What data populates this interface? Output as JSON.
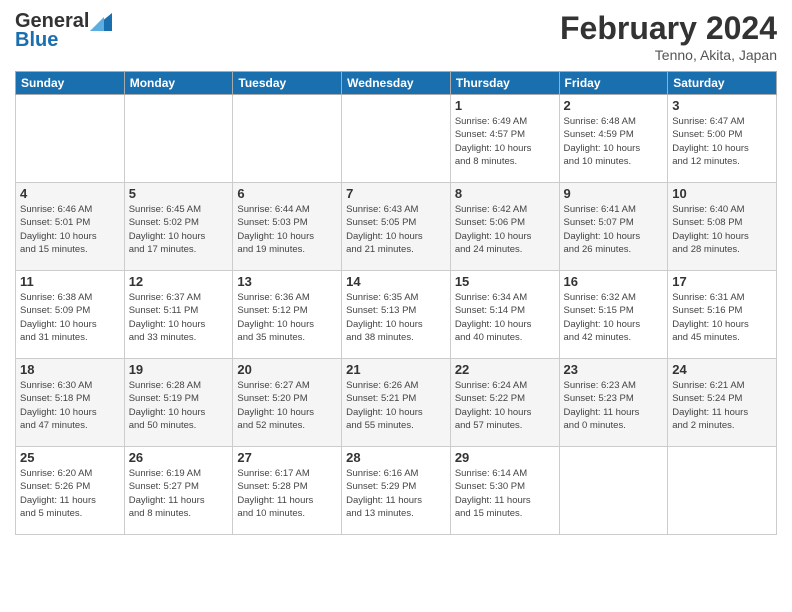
{
  "header": {
    "logo_line1": "General",
    "logo_line2": "Blue",
    "month_title": "February 2024",
    "subtitle": "Tenno, Akita, Japan"
  },
  "weekdays": [
    "Sunday",
    "Monday",
    "Tuesday",
    "Wednesday",
    "Thursday",
    "Friday",
    "Saturday"
  ],
  "weeks": [
    [
      {
        "day": "",
        "info": ""
      },
      {
        "day": "",
        "info": ""
      },
      {
        "day": "",
        "info": ""
      },
      {
        "day": "",
        "info": ""
      },
      {
        "day": "1",
        "info": "Sunrise: 6:49 AM\nSunset: 4:57 PM\nDaylight: 10 hours\nand 8 minutes."
      },
      {
        "day": "2",
        "info": "Sunrise: 6:48 AM\nSunset: 4:59 PM\nDaylight: 10 hours\nand 10 minutes."
      },
      {
        "day": "3",
        "info": "Sunrise: 6:47 AM\nSunset: 5:00 PM\nDaylight: 10 hours\nand 12 minutes."
      }
    ],
    [
      {
        "day": "4",
        "info": "Sunrise: 6:46 AM\nSunset: 5:01 PM\nDaylight: 10 hours\nand 15 minutes."
      },
      {
        "day": "5",
        "info": "Sunrise: 6:45 AM\nSunset: 5:02 PM\nDaylight: 10 hours\nand 17 minutes."
      },
      {
        "day": "6",
        "info": "Sunrise: 6:44 AM\nSunset: 5:03 PM\nDaylight: 10 hours\nand 19 minutes."
      },
      {
        "day": "7",
        "info": "Sunrise: 6:43 AM\nSunset: 5:05 PM\nDaylight: 10 hours\nand 21 minutes."
      },
      {
        "day": "8",
        "info": "Sunrise: 6:42 AM\nSunset: 5:06 PM\nDaylight: 10 hours\nand 24 minutes."
      },
      {
        "day": "9",
        "info": "Sunrise: 6:41 AM\nSunset: 5:07 PM\nDaylight: 10 hours\nand 26 minutes."
      },
      {
        "day": "10",
        "info": "Sunrise: 6:40 AM\nSunset: 5:08 PM\nDaylight: 10 hours\nand 28 minutes."
      }
    ],
    [
      {
        "day": "11",
        "info": "Sunrise: 6:38 AM\nSunset: 5:09 PM\nDaylight: 10 hours\nand 31 minutes."
      },
      {
        "day": "12",
        "info": "Sunrise: 6:37 AM\nSunset: 5:11 PM\nDaylight: 10 hours\nand 33 minutes."
      },
      {
        "day": "13",
        "info": "Sunrise: 6:36 AM\nSunset: 5:12 PM\nDaylight: 10 hours\nand 35 minutes."
      },
      {
        "day": "14",
        "info": "Sunrise: 6:35 AM\nSunset: 5:13 PM\nDaylight: 10 hours\nand 38 minutes."
      },
      {
        "day": "15",
        "info": "Sunrise: 6:34 AM\nSunset: 5:14 PM\nDaylight: 10 hours\nand 40 minutes."
      },
      {
        "day": "16",
        "info": "Sunrise: 6:32 AM\nSunset: 5:15 PM\nDaylight: 10 hours\nand 42 minutes."
      },
      {
        "day": "17",
        "info": "Sunrise: 6:31 AM\nSunset: 5:16 PM\nDaylight: 10 hours\nand 45 minutes."
      }
    ],
    [
      {
        "day": "18",
        "info": "Sunrise: 6:30 AM\nSunset: 5:18 PM\nDaylight: 10 hours\nand 47 minutes."
      },
      {
        "day": "19",
        "info": "Sunrise: 6:28 AM\nSunset: 5:19 PM\nDaylight: 10 hours\nand 50 minutes."
      },
      {
        "day": "20",
        "info": "Sunrise: 6:27 AM\nSunset: 5:20 PM\nDaylight: 10 hours\nand 52 minutes."
      },
      {
        "day": "21",
        "info": "Sunrise: 6:26 AM\nSunset: 5:21 PM\nDaylight: 10 hours\nand 55 minutes."
      },
      {
        "day": "22",
        "info": "Sunrise: 6:24 AM\nSunset: 5:22 PM\nDaylight: 10 hours\nand 57 minutes."
      },
      {
        "day": "23",
        "info": "Sunrise: 6:23 AM\nSunset: 5:23 PM\nDaylight: 11 hours\nand 0 minutes."
      },
      {
        "day": "24",
        "info": "Sunrise: 6:21 AM\nSunset: 5:24 PM\nDaylight: 11 hours\nand 2 minutes."
      }
    ],
    [
      {
        "day": "25",
        "info": "Sunrise: 6:20 AM\nSunset: 5:26 PM\nDaylight: 11 hours\nand 5 minutes."
      },
      {
        "day": "26",
        "info": "Sunrise: 6:19 AM\nSunset: 5:27 PM\nDaylight: 11 hours\nand 8 minutes."
      },
      {
        "day": "27",
        "info": "Sunrise: 6:17 AM\nSunset: 5:28 PM\nDaylight: 11 hours\nand 10 minutes."
      },
      {
        "day": "28",
        "info": "Sunrise: 6:16 AM\nSunset: 5:29 PM\nDaylight: 11 hours\nand 13 minutes."
      },
      {
        "day": "29",
        "info": "Sunrise: 6:14 AM\nSunset: 5:30 PM\nDaylight: 11 hours\nand 15 minutes."
      },
      {
        "day": "",
        "info": ""
      },
      {
        "day": "",
        "info": ""
      }
    ]
  ]
}
